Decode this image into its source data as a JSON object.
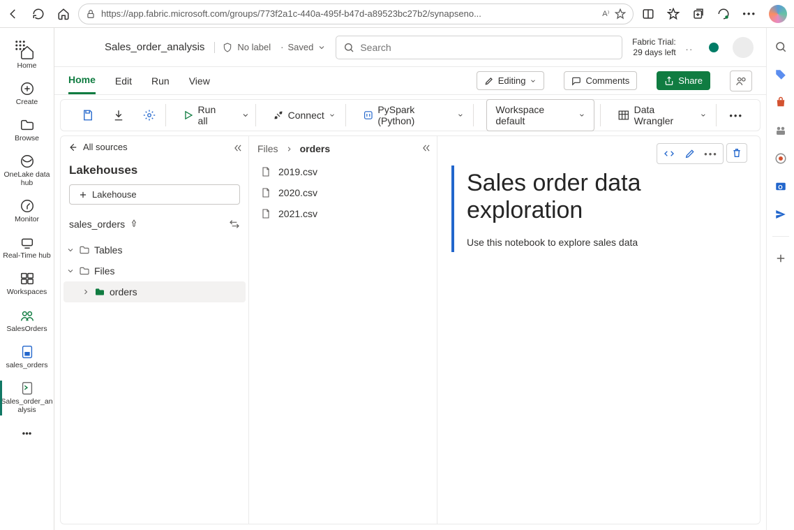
{
  "browser": {
    "url": "https://app.fabric.microsoft.com/groups/773f2a1c-440a-495f-b47d-a89523bc27b2/synapseno..."
  },
  "header": {
    "notebook_name": "Sales_order_analysis",
    "sensitivity": "No label",
    "saved": "Saved",
    "search_placeholder": "Search",
    "trial_line1": "Fabric Trial:",
    "trial_line2": "29 days left"
  },
  "ribbon": {
    "tabs": [
      "Home",
      "Edit",
      "Run",
      "View"
    ],
    "editing": "Editing",
    "comments": "Comments",
    "share": "Share"
  },
  "toolbar": {
    "runall": "Run all",
    "connect": "Connect",
    "lang": "PySpark (Python)",
    "env": "Workspace default",
    "wrangler": "Data Wrangler"
  },
  "leftrail": {
    "items": [
      {
        "label": "Home",
        "icon": "home"
      },
      {
        "label": "Create",
        "icon": "plus-circle"
      },
      {
        "label": "Browse",
        "icon": "folder"
      },
      {
        "label": "OneLake data hub",
        "icon": "onelake"
      },
      {
        "label": "Monitor",
        "icon": "monitor"
      },
      {
        "label": "Real-Time hub",
        "icon": "realtime"
      },
      {
        "label": "Workspaces",
        "icon": "workspaces"
      },
      {
        "label": "SalesOrders",
        "icon": "salesorders"
      },
      {
        "label": "sales_orders",
        "icon": "lakehouse"
      },
      {
        "label": "Sales_order_analysis",
        "icon": "notebook"
      }
    ]
  },
  "explorer": {
    "all_sources": "All sources",
    "title": "Lakehouses",
    "add": "Lakehouse",
    "source": "sales_orders",
    "nodes": {
      "tables": "Tables",
      "files": "Files",
      "orders": "orders"
    }
  },
  "filespanel": {
    "root": "Files",
    "current": "orders",
    "files": [
      "2019.csv",
      "2020.csv",
      "2021.csv"
    ]
  },
  "cell": {
    "title": "Sales order data exploration",
    "body": "Use this notebook to explore sales data"
  }
}
